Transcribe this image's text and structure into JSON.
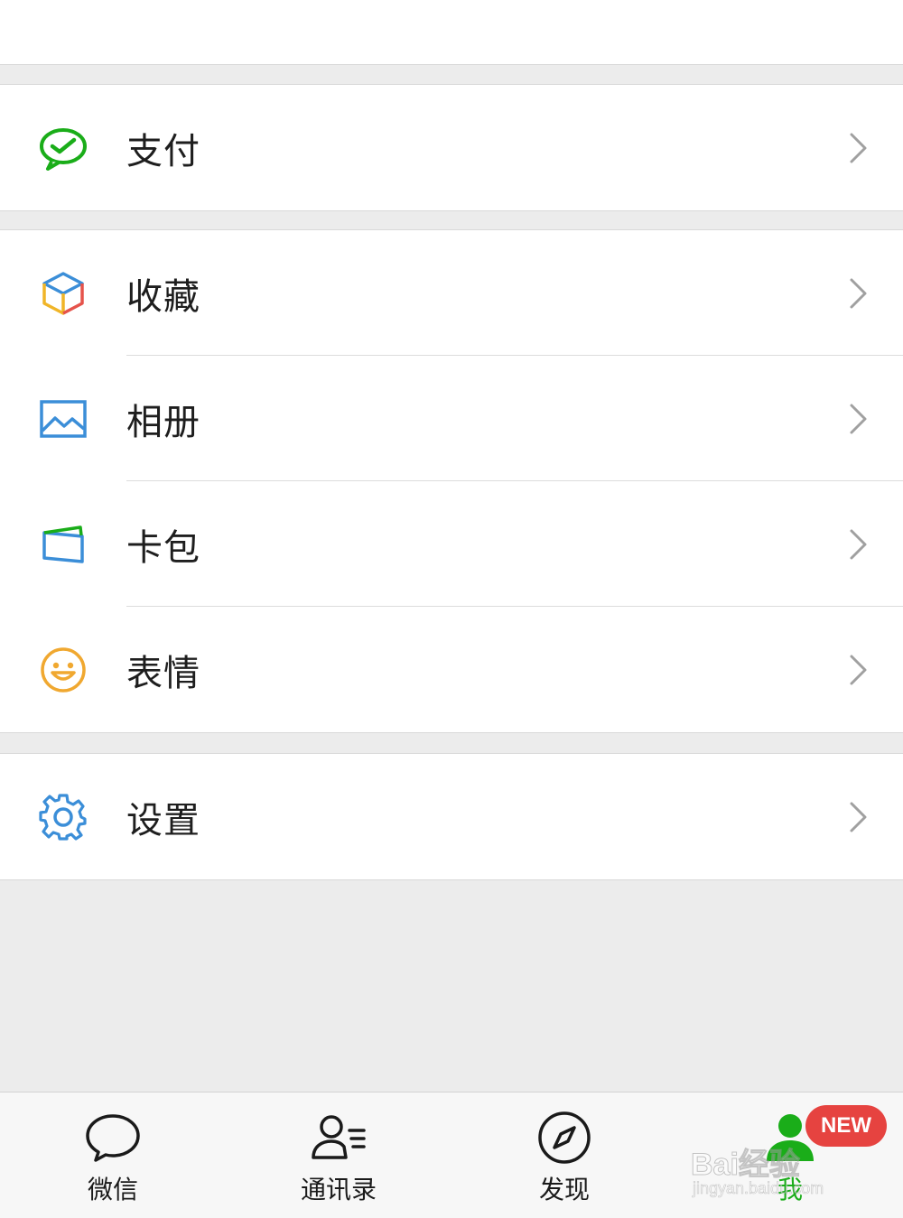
{
  "menu": {
    "pay": {
      "label": "支付"
    },
    "favorites": {
      "label": "收藏"
    },
    "album": {
      "label": "相册"
    },
    "cards": {
      "label": "卡包"
    },
    "stickers": {
      "label": "表情"
    },
    "settings": {
      "label": "设置"
    }
  },
  "tabbar": {
    "chats": {
      "label": "微信"
    },
    "contacts": {
      "label": "通讯录"
    },
    "discover": {
      "label": "发现"
    },
    "me": {
      "label": "我",
      "badge": "NEW"
    }
  },
  "watermark": {
    "text": "Bai经验",
    "url": "jingyan.baidu.com"
  },
  "colors": {
    "brand_green": "#1aad19",
    "badge_red": "#e64340",
    "background": "#ececec",
    "chevron": "#a0a0a0"
  },
  "icons": {
    "pay": "wallet-check-icon",
    "favorites": "cube-icon",
    "album": "picture-icon",
    "cards": "card-holder-icon",
    "stickers": "smiley-icon",
    "settings": "gear-icon",
    "chats": "chat-bubble-icon",
    "contacts": "contacts-icon",
    "discover": "compass-icon",
    "me": "person-icon"
  }
}
